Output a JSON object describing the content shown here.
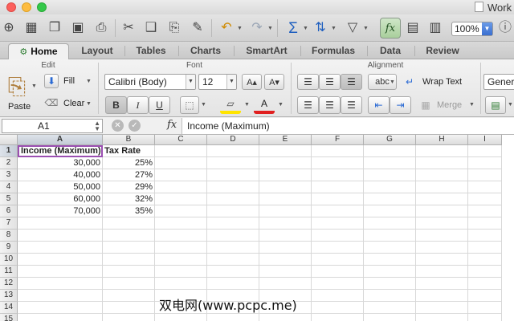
{
  "window": {
    "title": "Work"
  },
  "toolbar": {
    "zoom": "100%",
    "icons": [
      "new-workbook-icon",
      "templates-icon",
      "open-icon",
      "save-icon",
      "print-icon",
      "cut-icon",
      "copy-icon",
      "paste-icon",
      "format-painter-icon",
      "undo-icon",
      "redo-icon",
      "autosum-icon",
      "sort-icon",
      "filter-icon",
      "formula-builder-icon",
      "show-hide-icon",
      "gallery-icon",
      "toolbox-icon",
      "help-icon"
    ]
  },
  "ribbon": {
    "tabs": [
      {
        "label": "Home",
        "active": true
      },
      {
        "label": "Layout"
      },
      {
        "label": "Tables"
      },
      {
        "label": "Charts"
      },
      {
        "label": "SmartArt"
      },
      {
        "label": "Formulas"
      },
      {
        "label": "Data"
      },
      {
        "label": "Review"
      }
    ],
    "edit": {
      "title": "Edit",
      "paste": "Paste",
      "fill": "Fill",
      "clear": "Clear"
    },
    "font": {
      "title": "Font",
      "name": "Calibri (Body)",
      "size": "12",
      "bold": "B",
      "italic": "I",
      "underline": "U"
    },
    "alignment": {
      "title": "Alignment",
      "abc": "abc",
      "wrap_text": "Wrap Text",
      "merge": "Merge"
    },
    "number": {
      "format": "Genera"
    }
  },
  "formula_bar": {
    "name_box": "A1",
    "fx": "fx",
    "value": "Income (Maximum)"
  },
  "sheet": {
    "columns": [
      "A",
      "B",
      "C",
      "D",
      "E",
      "F",
      "G",
      "H",
      "I"
    ],
    "rows": [
      "1",
      "2",
      "3",
      "4",
      "5",
      "6",
      "7",
      "8",
      "9",
      "10",
      "11",
      "12",
      "13",
      "14",
      "15"
    ],
    "selected_cell": "A1",
    "headers": [
      "Income (Maximum)",
      "Tax Rate"
    ],
    "data": [
      [
        "30,000",
        "25%"
      ],
      [
        "40,000",
        "27%"
      ],
      [
        "50,000",
        "29%"
      ],
      [
        "60,000",
        "32%"
      ],
      [
        "70,000",
        "35%"
      ]
    ]
  },
  "watermark": "双电网(www.pcpc.me)"
}
